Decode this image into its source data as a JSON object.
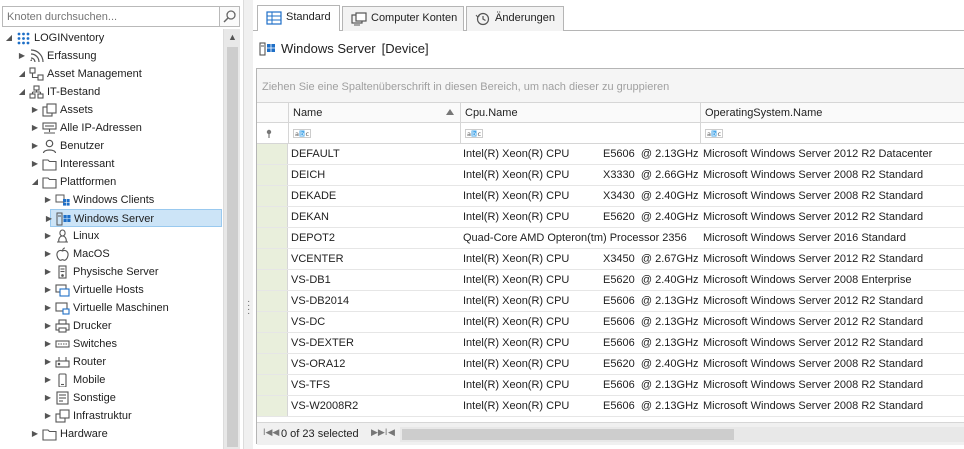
{
  "search": {
    "placeholder": "Knoten durchsuchen..."
  },
  "tree": [
    {
      "label": "LOGINventory",
      "icon": "loginventory-icon",
      "expanded": true,
      "level": 0
    },
    {
      "label": "Erfassung",
      "icon": "wifi-icon",
      "expanded": false,
      "level": 1
    },
    {
      "label": "Asset Management",
      "icon": "asset-management-icon",
      "expanded": true,
      "level": 1
    },
    {
      "label": "IT-Bestand",
      "icon": "network-icon",
      "expanded": true,
      "level": 2
    },
    {
      "label": "Assets",
      "icon": "assets-icon",
      "expanded": false,
      "level": 3
    },
    {
      "label": "Alle IP-Adressen",
      "icon": "ip-address-icon",
      "expanded": false,
      "level": 3
    },
    {
      "label": "Benutzer",
      "icon": "user-icon",
      "expanded": false,
      "level": 3
    },
    {
      "label": "Interessant",
      "icon": "folder-icon",
      "expanded": false,
      "level": 3
    },
    {
      "label": "Plattformen",
      "icon": "folder-icon",
      "expanded": true,
      "level": 3
    },
    {
      "label": "Windows Clients",
      "icon": "windows-icon",
      "expanded": false,
      "level": 4
    },
    {
      "label": "Windows Server",
      "icon": "windows-server-icon",
      "expanded": false,
      "level": 4,
      "selected": true
    },
    {
      "label": "Linux",
      "icon": "linux-icon",
      "expanded": false,
      "level": 4
    },
    {
      "label": "MacOS",
      "icon": "apple-icon",
      "expanded": false,
      "level": 4
    },
    {
      "label": "Physische Server",
      "icon": "server-icon",
      "expanded": false,
      "level": 4
    },
    {
      "label": "Virtuelle Hosts",
      "icon": "virtual-host-icon",
      "expanded": false,
      "level": 4
    },
    {
      "label": "Virtuelle Maschinen",
      "icon": "virtual-machine-icon",
      "expanded": false,
      "level": 4
    },
    {
      "label": "Drucker",
      "icon": "printer-icon",
      "expanded": false,
      "level": 4
    },
    {
      "label": "Switches",
      "icon": "switch-icon",
      "expanded": false,
      "level": 4
    },
    {
      "label": "Router",
      "icon": "router-icon",
      "expanded": false,
      "level": 4
    },
    {
      "label": "Mobile",
      "icon": "mobile-icon",
      "expanded": false,
      "level": 4
    },
    {
      "label": "Sonstige",
      "icon": "other-device-icon",
      "expanded": false,
      "level": 4
    },
    {
      "label": "Infrastruktur",
      "icon": "infrastructure-icon",
      "expanded": false,
      "level": 4
    },
    {
      "label": "Hardware",
      "icon": "folder-icon",
      "expanded": false,
      "level": 3
    }
  ],
  "tabs": [
    {
      "label": "Standard",
      "icon": "table-icon",
      "active": true
    },
    {
      "label": "Computer Konten",
      "icon": "computer-accounts-icon",
      "active": false
    },
    {
      "label": "Änderungen",
      "icon": "history-icon",
      "active": false
    }
  ],
  "device": {
    "title": "Windows Server",
    "type": "[Device]"
  },
  "grid": {
    "group_hint": "Ziehen Sie eine Spaltenüberschrift in diesen Bereich, um nach dieser zu gruppieren",
    "columns": [
      "Name",
      "Cpu.Name",
      "OperatingSystem.Name"
    ],
    "filter_icon": "abc-filter-icon",
    "rows": [
      [
        "DEFAULT",
        "Intel(R) Xeon(R) CPU           E5606  @ 2.13GHz",
        "Microsoft Windows Server 2012 R2 Datacenter"
      ],
      [
        "DEICH",
        "Intel(R) Xeon(R) CPU           X3330  @ 2.66GHz",
        "Microsoft Windows Server 2008 R2 Standard"
      ],
      [
        "DEKADE",
        "Intel(R) Xeon(R) CPU           X3430  @ 2.40GHz",
        "Microsoft Windows Server 2008 R2 Standard"
      ],
      [
        "DEKAN",
        "Intel(R) Xeon(R) CPU           E5620  @ 2.40GHz",
        "Microsoft Windows Server 2012 R2 Standard"
      ],
      [
        "DEPOT2",
        "Quad-Core AMD Opteron(tm) Processor 2356",
        "Microsoft Windows Server 2016 Standard"
      ],
      [
        "VCENTER",
        "Intel(R) Xeon(R) CPU           X3450  @ 2.67GHz",
        "Microsoft Windows Server 2012 R2 Standard"
      ],
      [
        "VS-DB1",
        "Intel(R) Xeon(R) CPU           E5620  @ 2.40GHz",
        "Microsoft Windows Server 2008 Enterprise"
      ],
      [
        "VS-DB2014",
        "Intel(R) Xeon(R) CPU           E5606  @ 2.13GHz",
        "Microsoft Windows Server 2012 R2 Standard"
      ],
      [
        "VS-DC",
        "Intel(R) Xeon(R) CPU           E5606  @ 2.13GHz",
        "Microsoft Windows Server 2012 R2 Standard"
      ],
      [
        "VS-DEXTER",
        "Intel(R) Xeon(R) CPU           E5606  @ 2.13GHz",
        "Microsoft Windows Server 2012 R2 Standard"
      ],
      [
        "VS-ORA12",
        "Intel(R) Xeon(R) CPU           E5620  @ 2.40GHz",
        "Microsoft Windows Server 2008 R2 Standard"
      ],
      [
        "VS-TFS",
        "Intel(R) Xeon(R) CPU           E5606  @ 2.13GHz",
        "Microsoft Windows Server 2008 R2 Standard"
      ],
      [
        "VS-W2008R2",
        "Intel(R) Xeon(R) CPU           E5606  @ 2.13GHz",
        "Microsoft Windows Server 2008 R2 Standard"
      ]
    ]
  },
  "footer": {
    "selection": "0 of 23 selected"
  },
  "colors": {
    "selection": "#cce4f7",
    "row_indicator": "#e9efdc",
    "accent": "#1e6fc7"
  }
}
